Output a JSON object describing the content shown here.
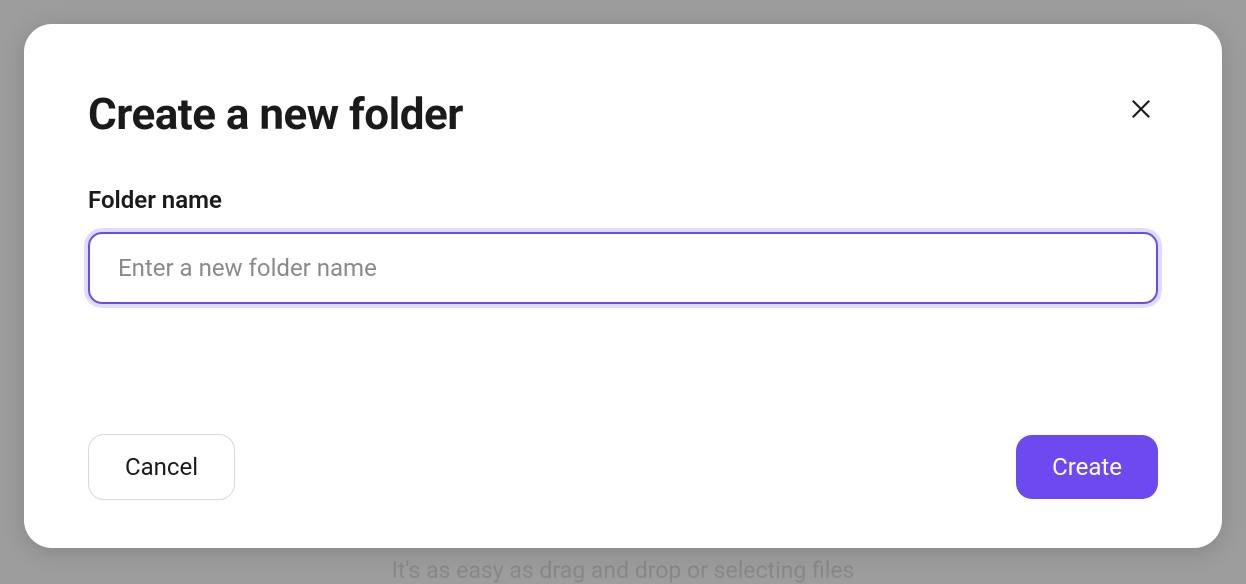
{
  "modal": {
    "title": "Create a new folder",
    "field_label": "Folder name",
    "input_placeholder": "Enter a new folder name",
    "input_value": "",
    "cancel_label": "Cancel",
    "create_label": "Create"
  },
  "backdrop": {
    "hint_text": "It's as easy as drag and drop or selecting files"
  },
  "colors": {
    "accent": "#6d4aef",
    "accent_glow": "#e1dcfa",
    "text": "#1a1a1a",
    "placeholder": "#8a8a8a",
    "backdrop": "#9d9d9d"
  }
}
